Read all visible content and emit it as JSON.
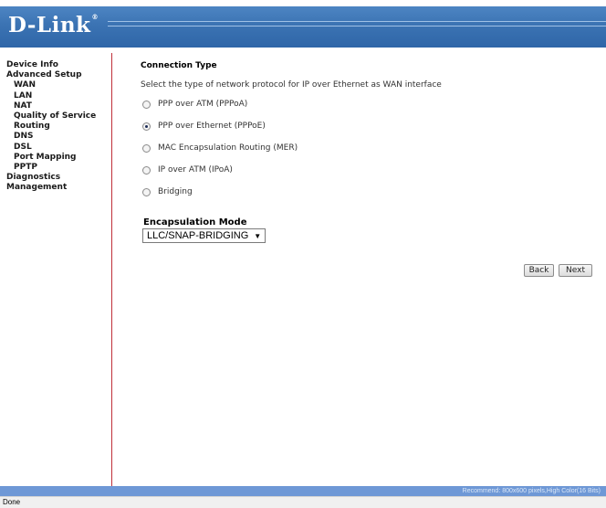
{
  "brand": {
    "logo": "D-Link",
    "reg_mark": "®"
  },
  "sidebar": {
    "items": [
      {
        "label": "Device Info",
        "level": 0
      },
      {
        "label": "Advanced Setup",
        "level": 0
      },
      {
        "label": "WAN",
        "level": 1
      },
      {
        "label": "LAN",
        "level": 1
      },
      {
        "label": "NAT",
        "level": 1
      },
      {
        "label": "Quality of Service",
        "level": 1
      },
      {
        "label": "Routing",
        "level": 1
      },
      {
        "label": "DNS",
        "level": 1
      },
      {
        "label": "DSL",
        "level": 1
      },
      {
        "label": "Port Mapping",
        "level": 1
      },
      {
        "label": "PPTP",
        "level": 1
      },
      {
        "label": "Diagnostics",
        "level": 0
      },
      {
        "label": "Management",
        "level": 0
      }
    ]
  },
  "main": {
    "title": "Connection Type",
    "description": "Select the type of network protocol for IP over Ethernet as WAN interface",
    "options": [
      {
        "label": "PPP over ATM (PPPoA)",
        "checked": false
      },
      {
        "label": "PPP over Ethernet (PPPoE)",
        "checked": true
      },
      {
        "label": "MAC Encapsulation Routing (MER)",
        "checked": false
      },
      {
        "label": "IP over ATM (IPoA)",
        "checked": false
      },
      {
        "label": "Bridging",
        "checked": false
      }
    ],
    "encapsulation": {
      "label": "Encapsulation Mode",
      "value": "LLC/SNAP-BRIDGING"
    },
    "buttons": {
      "back": "Back",
      "next": "Next"
    }
  },
  "footer": {
    "recommend": "Recommend: 800x600 pixels,High Color(16 Bits)"
  },
  "statusbar": {
    "text": "Done"
  },
  "colors": {
    "header_blue": "#3b73b3",
    "footer_blue": "#6e98d6",
    "divider_red": "#c0303a"
  }
}
